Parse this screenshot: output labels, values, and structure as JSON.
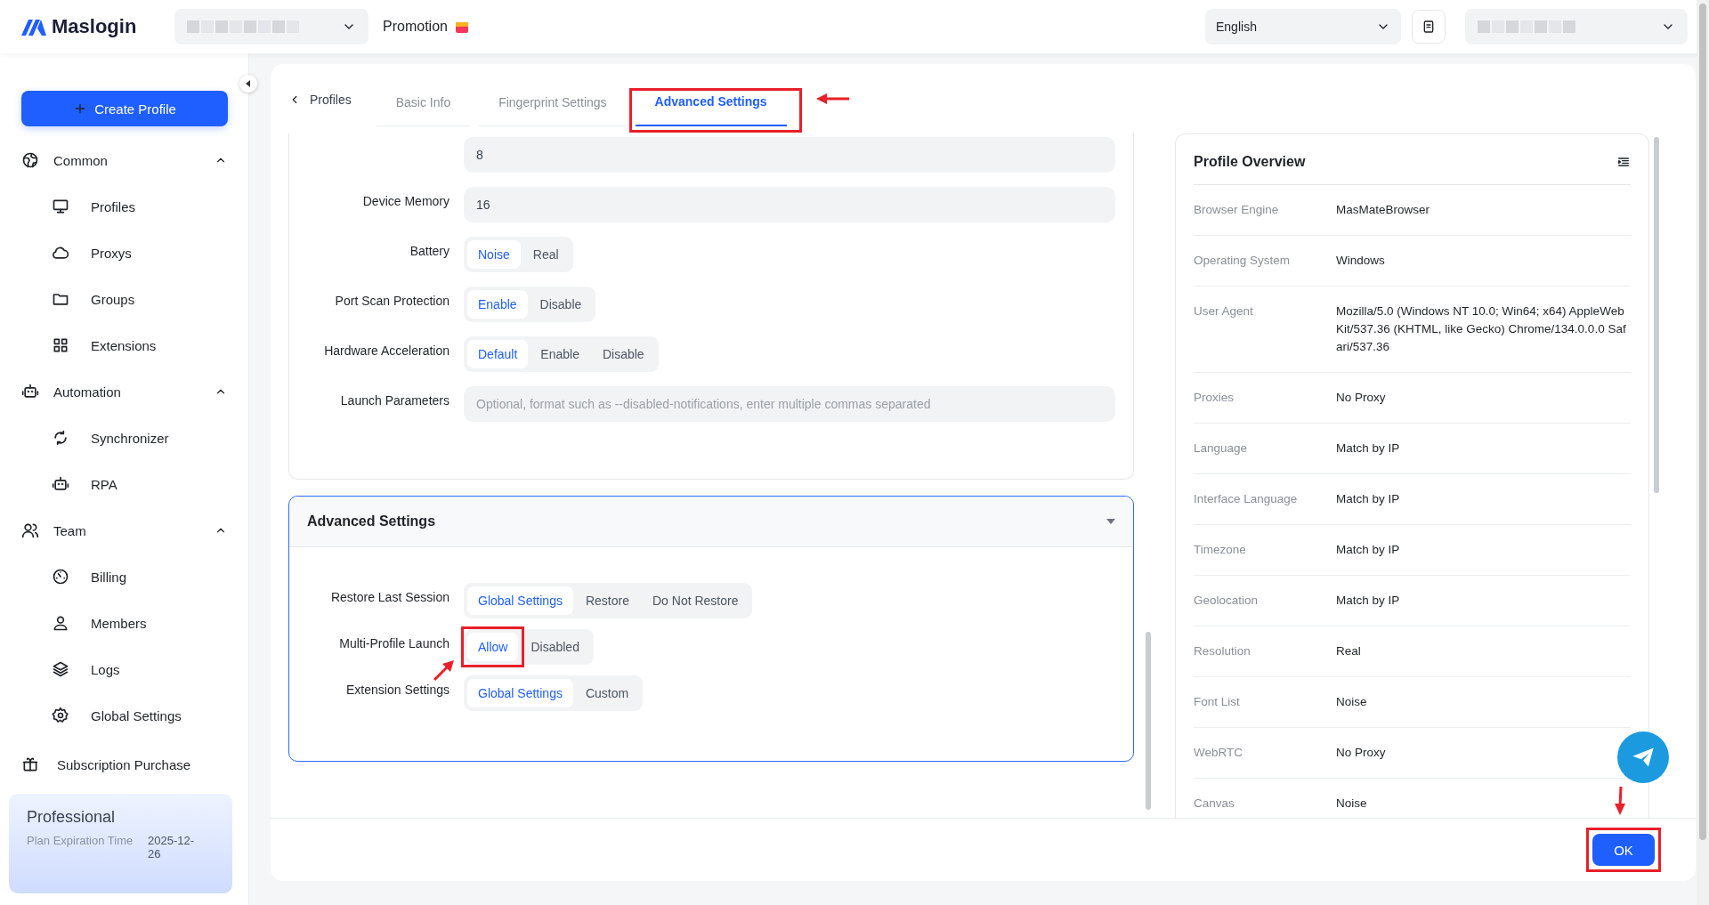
{
  "header": {
    "logo": "Maslogin",
    "promotion": "Promotion",
    "language": "English"
  },
  "sidebar": {
    "create_button": "Create Profile",
    "groups": [
      {
        "label": "Common",
        "expanded": true,
        "children": [
          {
            "label": "Profiles"
          },
          {
            "label": "Proxys"
          },
          {
            "label": "Groups"
          },
          {
            "label": "Extensions"
          }
        ]
      },
      {
        "label": "Automation",
        "expanded": true,
        "children": [
          {
            "label": "Synchronizer"
          },
          {
            "label": "RPA"
          }
        ]
      },
      {
        "label": "Team",
        "expanded": true,
        "children": [
          {
            "label": "Billing"
          },
          {
            "label": "Members"
          },
          {
            "label": "Logs"
          },
          {
            "label": "Global Settings"
          }
        ]
      }
    ],
    "subscription": "Subscription Purchase",
    "plan": {
      "name": "Professional",
      "expiry_label": "Plan Expiration Time",
      "expiry_value": "2025-12-26"
    }
  },
  "tabs": {
    "back": "Profiles",
    "items": [
      {
        "label": "Basic Info",
        "selected": false,
        "highlighted": false
      },
      {
        "label": "Fingerprint Settings",
        "selected": false,
        "highlighted": false
      },
      {
        "label": "Advanced Settings",
        "selected": true,
        "highlighted": true
      }
    ]
  },
  "form": {
    "rows": [
      {
        "kind": "input",
        "label": "",
        "value": "8"
      },
      {
        "kind": "input",
        "label": "Device Memory",
        "value": "16"
      },
      {
        "kind": "segmented",
        "label": "Battery",
        "options": [
          {
            "label": "Noise",
            "selected": true,
            "highlighted": false
          },
          {
            "label": "Real",
            "selected": false,
            "highlighted": false
          }
        ]
      },
      {
        "kind": "segmented",
        "label": "Port Scan Protection",
        "options": [
          {
            "label": "Enable",
            "selected": true,
            "highlighted": false
          },
          {
            "label": "Disable",
            "selected": false,
            "highlighted": false
          }
        ]
      },
      {
        "kind": "segmented",
        "label": "Hardware Acceleration",
        "options": [
          {
            "label": "Default",
            "selected": true,
            "highlighted": false
          },
          {
            "label": "Enable",
            "selected": false,
            "highlighted": false
          },
          {
            "label": "Disable",
            "selected": false,
            "highlighted": false
          }
        ]
      },
      {
        "kind": "input",
        "label": "Launch Parameters",
        "placeholder": "Optional, format such as --disabled-notifications, enter multiple commas separated"
      }
    ],
    "section": {
      "title": "Advanced Settings",
      "expanded": true,
      "rows": [
        {
          "kind": "segmented",
          "label": "Restore Last Session",
          "options": [
            {
              "label": "Global Settings",
              "selected": true,
              "highlighted": false
            },
            {
              "label": "Restore",
              "selected": false,
              "highlighted": false
            },
            {
              "label": "Do Not Restore",
              "selected": false,
              "highlighted": false
            }
          ]
        },
        {
          "kind": "segmented",
          "label": "Multi-Profile Launch",
          "options": [
            {
              "label": "Allow",
              "selected": true,
              "highlighted": true
            },
            {
              "label": "Disabled",
              "selected": false,
              "highlighted": false
            }
          ]
        },
        {
          "kind": "segmented",
          "label": "Extension Settings",
          "options": [
            {
              "label": "Global Settings",
              "selected": true,
              "highlighted": false
            },
            {
              "label": "Custom",
              "selected": false,
              "highlighted": false
            }
          ]
        }
      ]
    }
  },
  "overview": {
    "title": "Profile Overview",
    "rows": [
      {
        "label": "Browser Engine",
        "value": "MasMateBrowser"
      },
      {
        "label": "Operating System",
        "value": "Windows"
      },
      {
        "label": "User Agent",
        "value": "Mozilla/5.0 (Windows NT 10.0; Win64; x64) AppleWebKit/537.36 (KHTML, like Gecko) Chrome/134.0.0.0 Safari/537.36"
      },
      {
        "label": "Proxies",
        "value": "No Proxy"
      },
      {
        "label": "Language",
        "value": "Match by IP"
      },
      {
        "label": "Interface Language",
        "value": "Match by IP"
      },
      {
        "label": "Timezone",
        "value": "Match by IP"
      },
      {
        "label": "Geolocation",
        "value": "Match by IP"
      },
      {
        "label": "Resolution",
        "value": "Real"
      },
      {
        "label": "Font List",
        "value": "Noise"
      },
      {
        "label": "WebRTC",
        "value": "No Proxy"
      },
      {
        "label": "Canvas",
        "value": "Noise"
      }
    ]
  },
  "footer": {
    "ok": {
      "label": "OK",
      "highlighted": true
    }
  }
}
